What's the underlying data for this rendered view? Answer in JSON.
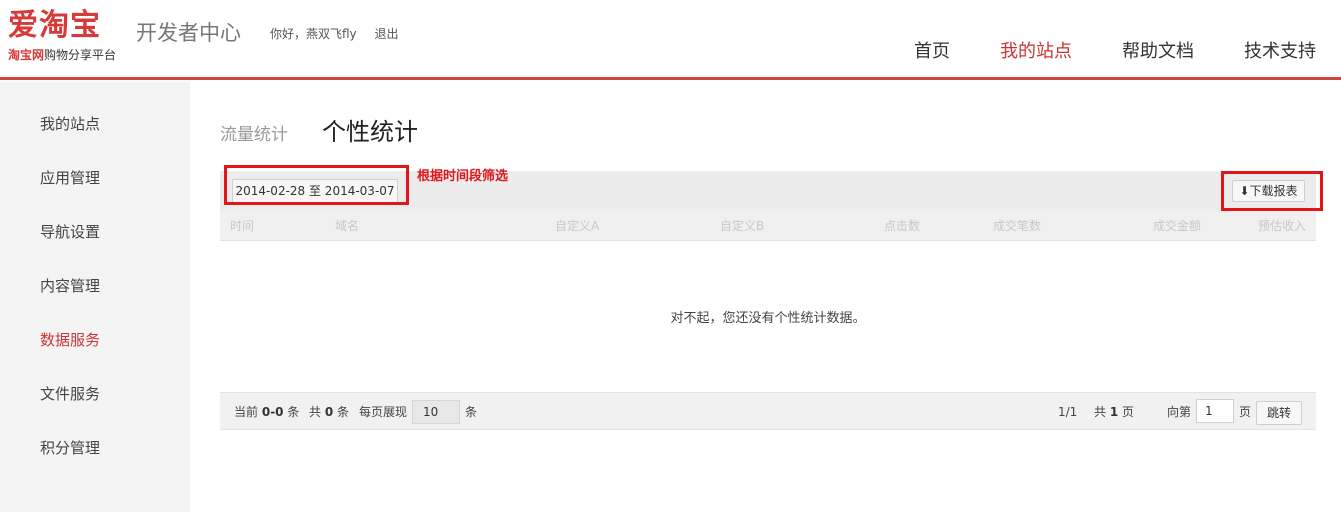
{
  "header": {
    "logo_main": "爱淘宝",
    "logo_sub_brand": "淘宝网",
    "logo_sub_text": "购物分享平台",
    "dev_center": "开发者中心",
    "greeting": "你好，燕双飞fly",
    "logout": "退出",
    "nav": [
      {
        "label": "首页"
      },
      {
        "label": "我的站点"
      },
      {
        "label": "帮助文档"
      },
      {
        "label": "技术支持"
      }
    ],
    "active_color": "#c83535"
  },
  "sidebar": {
    "items": [
      {
        "label": "我的站点"
      },
      {
        "label": "应用管理"
      },
      {
        "label": "导航设置"
      },
      {
        "label": "内容管理"
      },
      {
        "label": "数据服务"
      },
      {
        "label": "文件服务"
      },
      {
        "label": "积分管理"
      }
    ],
    "active_item": "数据服务"
  },
  "tabs": [
    {
      "label": "流量统计"
    },
    {
      "label": "个性统计"
    }
  ],
  "toolbar": {
    "date_range": "2014-02-28 至 2014-03-07",
    "annotation": "根据时间段筛选",
    "download": "⬇下载报表"
  },
  "table": {
    "columns": [
      "时间",
      "域名",
      "自定义A",
      "自定义B",
      "点击数",
      "成交笔数",
      "成交金额",
      "预估收入"
    ],
    "empty_message": "对不起，您还没有个性统计数据。"
  },
  "pager": {
    "current_label": "当前",
    "current_range": "0-0",
    "unit_tiao": "条",
    "total_label": "共",
    "total": "0",
    "per_page_label": "每页展现",
    "per_page": "10",
    "page_status": "1/1",
    "total_pages_label": "共",
    "total_pages": "1",
    "page_unit": "页",
    "goto_label": "向第",
    "goto_value": "1",
    "jump": "跳转"
  },
  "colors": {
    "brand_red": "#d44141",
    "annotation_red": "#e0161a"
  }
}
